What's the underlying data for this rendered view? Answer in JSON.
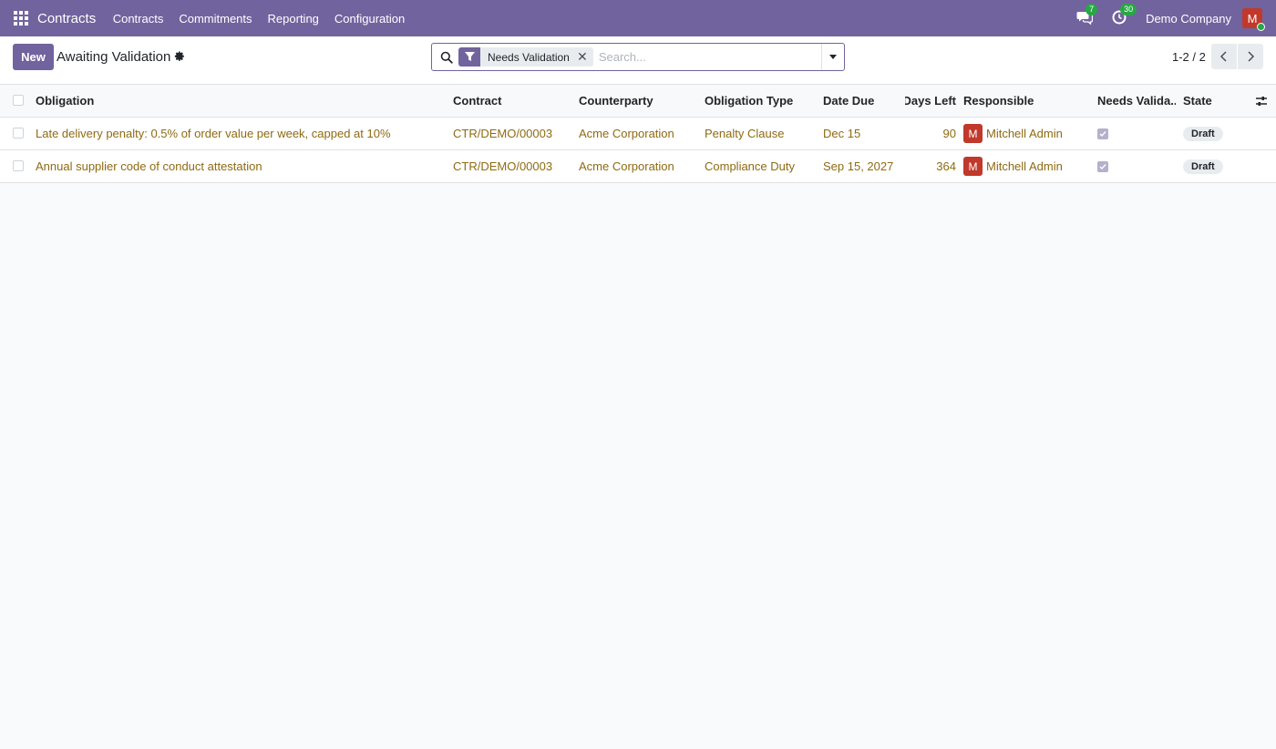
{
  "navbar": {
    "brand": "Contracts",
    "menu": [
      {
        "label": "Contracts"
      },
      {
        "label": "Commitments"
      },
      {
        "label": "Reporting"
      },
      {
        "label": "Configuration"
      }
    ],
    "messages_count": "7",
    "activities_count": "30",
    "company": "Demo Company",
    "user_initial": "M"
  },
  "control": {
    "new_label": "New",
    "title": "Awaiting Validation",
    "facet_label": "Needs Validation",
    "search_placeholder": "Search...",
    "pager": "1-2 / 2"
  },
  "table": {
    "headers": {
      "obligation": "Obligation",
      "contract": "Contract",
      "counterparty": "Counterparty",
      "type": "Obligation Type",
      "date_due": "Date Due",
      "days_left": "Days Left",
      "responsible": "Responsible",
      "needs_validation": "Needs Valida...",
      "state": "State"
    },
    "rows": [
      {
        "obligation": "Late delivery penalty: 0.5% of order value per week, capped at 10%",
        "contract": "CTR/DEMO/00003",
        "counterparty": "Acme Corporation",
        "type": "Penalty Clause",
        "date_due": "Dec 15",
        "days_left": "90",
        "responsible_initial": "M",
        "responsible": "Mitchell Admin",
        "needs_validation": true,
        "state": "Draft"
      },
      {
        "obligation": "Annual supplier code of conduct attestation",
        "contract": "CTR/DEMO/00003",
        "counterparty": "Acme Corporation",
        "type": "Compliance Duty",
        "date_due": "Sep 15, 2027",
        "days_left": "364",
        "responsible_initial": "M",
        "responsible": "Mitchell Admin",
        "needs_validation": true,
        "state": "Draft"
      }
    ]
  },
  "colors": {
    "brand": "#71639e",
    "link": "#8f6a12",
    "avatar": "#c0392b",
    "badge": "#28a745"
  }
}
